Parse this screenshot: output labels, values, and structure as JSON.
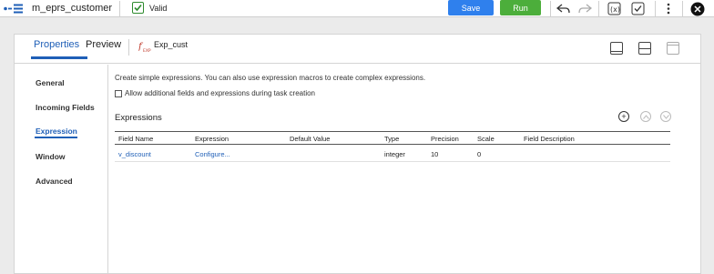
{
  "topbar": {
    "mapping_name": "m_eprs_customer",
    "validation_status": "Valid",
    "save_label": "Save",
    "run_label": "Run",
    "icons": [
      "mapping-icon",
      "undo-icon",
      "redo-icon",
      "expression-function-icon",
      "validate-icon",
      "more-options-icon",
      "close-icon"
    ]
  },
  "panel": {
    "tabs": [
      {
        "label": "Properties",
        "active": true
      },
      {
        "label": "Preview",
        "active": false
      }
    ],
    "object_name": "Exp_cust",
    "object_icon": "expression-transformation-icon",
    "layout_icons": [
      "layout-maximize-icon",
      "layout-split-icon",
      "layout-minimize-icon"
    ]
  },
  "sidenav": {
    "items": [
      {
        "label": "General",
        "active": false
      },
      {
        "label": "Incoming Fields",
        "active": false
      },
      {
        "label": "Expression",
        "active": true
      },
      {
        "label": "Window",
        "active": false
      },
      {
        "label": "Advanced",
        "active": false
      }
    ]
  },
  "content": {
    "description": "Create simple expressions. You can also use expression macros to create complex expressions.",
    "checkbox_label": "Allow additional fields and expressions during task creation",
    "checkbox_checked": false,
    "section_title": "Expressions",
    "columns": [
      "Field Name",
      "Expression",
      "Default Value",
      "Type",
      "Precision",
      "Scale",
      "Field Description"
    ],
    "rows": [
      {
        "field_name": "v_discount",
        "expression": "Configure...",
        "default_value": "",
        "type": "integer",
        "precision": "10",
        "scale": "0",
        "field_description": ""
      }
    ]
  },
  "colors": {
    "accent": "#1f5fb7",
    "save": "#2f80ed",
    "run": "#4cae3b",
    "valid": "#2e8b2e"
  }
}
